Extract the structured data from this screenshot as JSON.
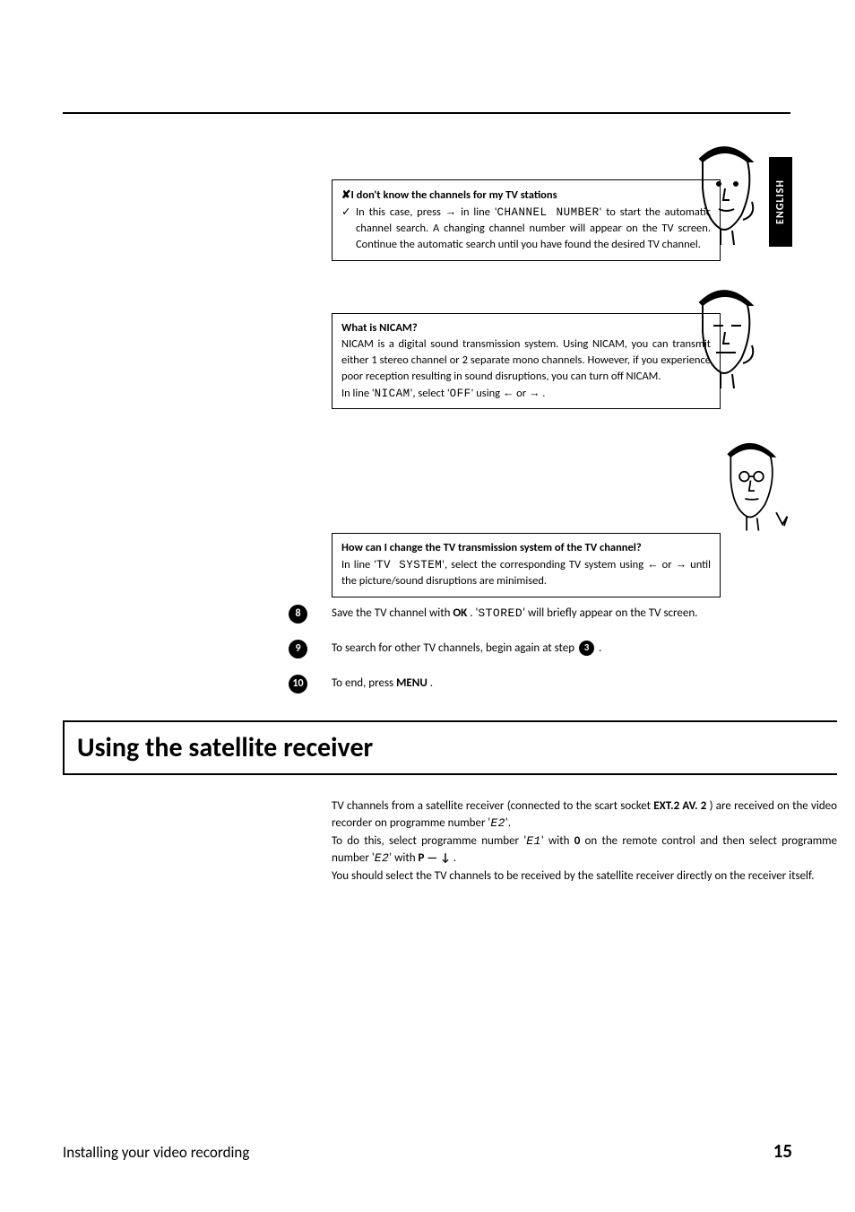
{
  "language_tab": "ENGLISH",
  "box1": {
    "heading": "I don't know the channels for my TV stations",
    "body": "In this case, press → in line 'CHANNEL NUMBER' to start the automatic channel search. A changing channel number will appear on the TV screen. Continue the automatic search until you have found the desired TV channel."
  },
  "box2": {
    "heading": "What is NICAM?",
    "body1": "NICAM is a digital sound transmission system. Using NICAM, you can transmit either 1 stereo channel or 2 separate mono channels. However, if you experience poor reception resulting in sound disruptions, you can turn off NICAM.",
    "body2": "In line 'NICAM', select 'OFF' using ← or → ."
  },
  "box3": {
    "heading": "How can I change the TV transmission system of the TV channel?",
    "body": "In line 'TV SYSTEM', select the corresponding TV system using ← or → until the picture/sound disruptions are minimised."
  },
  "steps": {
    "s8_num": "8",
    "s8_text_a": "Save the TV channel with ",
    "s8_key": "OK",
    "s8_text_b": " . '",
    "s8_code": "STORED",
    "s8_text_c": "' will briefly appear on the TV screen.",
    "s9_num": "9",
    "s9_text_a": "To search for other TV channels, begin again at step ",
    "s9_ref": "3",
    "s9_text_b": " .",
    "s10_num": "10",
    "s10_text_a": "To end, press ",
    "s10_key": "MENU",
    "s10_text_b": " ."
  },
  "section": {
    "title": "Using the satellite receiver",
    "p1a": "TV channels from a satellite receiver (connected to the scart socket ",
    "p1key": "EXT.2 AV. 2",
    "p1b": " ) are received on the video recorder on programme number '",
    "p1code": "E2",
    "p1c": "'.",
    "p2a": "To do this, select programme number '",
    "p2code1": "E1",
    "p2b": "' with ",
    "p2key1": "0",
    "p2c": " on the remote control and then select programme number '",
    "p2code2": "E2",
    "p2d": "' with ",
    "p2key2": "P — ↓",
    "p2e": " .",
    "p3": "You should select the TV channels to be received by the satellite receiver directly on the receiver itself."
  },
  "footer": {
    "left": "Installing your video recording",
    "page": "15"
  }
}
